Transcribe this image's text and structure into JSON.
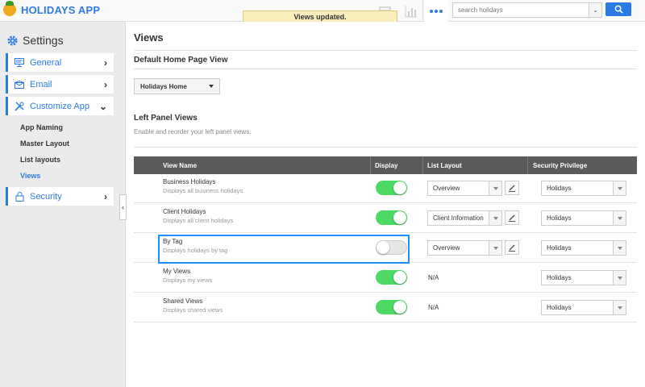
{
  "app": {
    "title": "HOLIDAYS APP"
  },
  "toast": {
    "message": "Views updated."
  },
  "search": {
    "placeholder": "search holidays"
  },
  "sidebar": {
    "heading": "Settings",
    "items": [
      {
        "label": "General",
        "icon": "monitor-icon"
      },
      {
        "label": "Email",
        "icon": "envelope-icon"
      },
      {
        "label": "Customize App",
        "icon": "tools-icon"
      },
      {
        "label": "Security",
        "icon": "lock-icon"
      }
    ],
    "subitems": [
      "App Naming",
      "Master Layout",
      "List layouts",
      "Views"
    ],
    "active_subitem": "Views"
  },
  "main": {
    "title": "Views",
    "default_home": {
      "heading": "Default Home Page View",
      "value": "Holidays Home"
    },
    "left_panel": {
      "heading": "Left Panel Views",
      "description": "Enable and reorder your left panel views."
    },
    "table": {
      "headers": [
        "View Name",
        "Display",
        "List Layout",
        "Security Privilege"
      ],
      "rows": [
        {
          "name": "Business Holidays",
          "desc": "Displays all business holidays",
          "display": true,
          "layout": "Overview",
          "privilege": "Holidays"
        },
        {
          "name": "Client Holidays",
          "desc": "Displays all client holidays",
          "display": true,
          "layout": "Client Information",
          "privilege": "Holidays"
        },
        {
          "name": "By Tag",
          "desc": "Displays holidays by tag",
          "display": false,
          "layout": "Overview",
          "privilege": "Holidays"
        },
        {
          "name": "My Views",
          "desc": "Displays my views",
          "display": true,
          "layout": "N/A",
          "privilege": "Holidays"
        },
        {
          "name": "Shared Views",
          "desc": "Displays shared views",
          "display": true,
          "layout": "N/A",
          "privilege": "Holidays"
        }
      ]
    }
  },
  "colors": {
    "accent": "#2c7be5",
    "toggle_on": "#4cd964",
    "header_bg": "#5a5a5a",
    "toast_bg": "#fbeebd"
  }
}
